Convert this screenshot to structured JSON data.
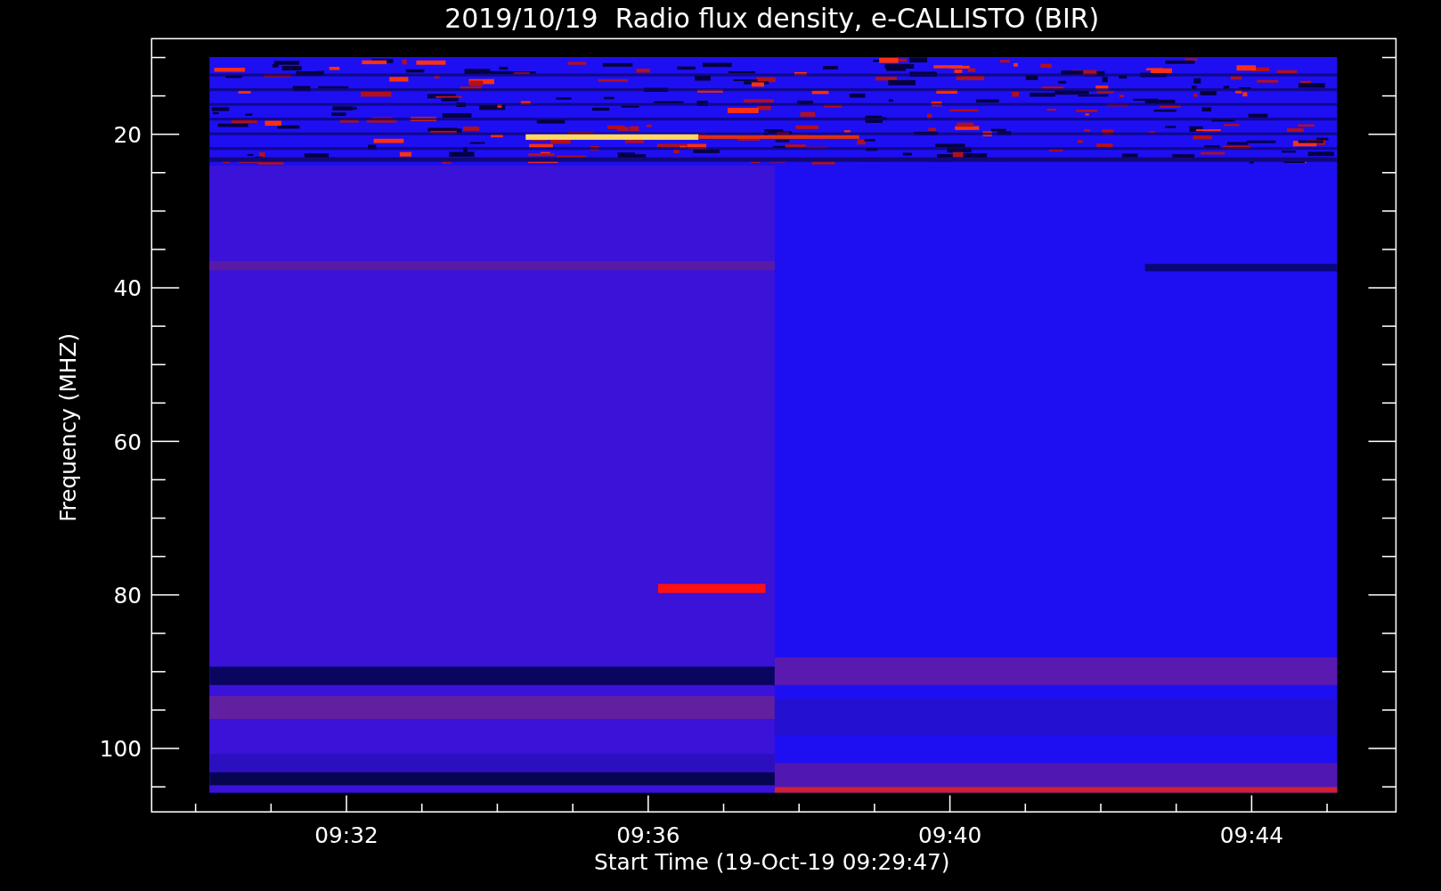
{
  "title": "2019/10/19  Radio flux density, e-CALLISTO (BIR)",
  "y_axis": {
    "label": "Frequency (MHZ)",
    "ticks": [
      "20",
      "40",
      "60",
      "80",
      "100"
    ]
  },
  "x_axis": {
    "label": "Start Time (19-Oct-19 09:29:47)",
    "ticks": [
      "09:32",
      "09:36",
      "09:40",
      "09:44"
    ]
  }
}
